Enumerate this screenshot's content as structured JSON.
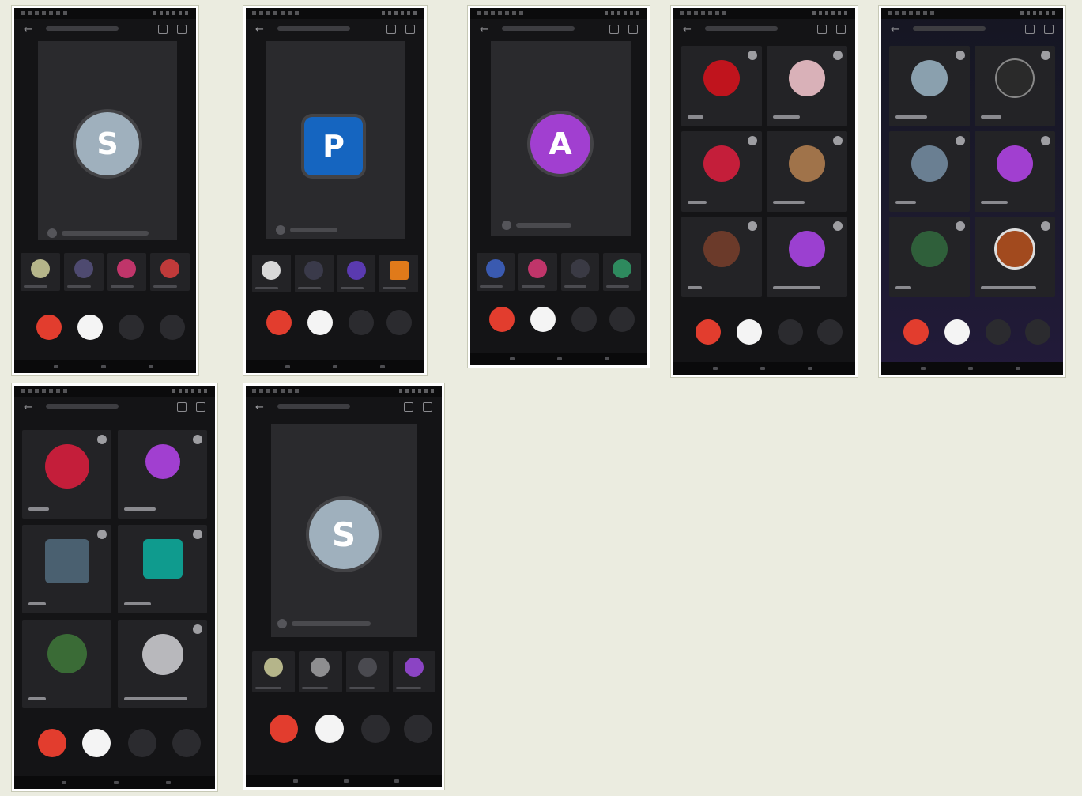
{
  "screens": {
    "s1": {
      "initial": "S",
      "avatar_color": "#9fb0bd"
    },
    "s2": {
      "initial": "P",
      "avatar_color": "#1565c0"
    },
    "s3": {
      "initial": "A",
      "avatar_color": "#a13fd0"
    },
    "s4": {
      "tile_colors": [
        "#c0141d",
        "#d9b1b8",
        "#c41e3a",
        "#a0734a",
        "#6b3a2a",
        "#9b40d0"
      ]
    },
    "s5": {
      "tile_colors": [
        "#8aa0ae",
        "#2a2a2a",
        "#6a7f92",
        "#a13fd0",
        "#2f5f3a",
        "#a24a1e"
      ]
    },
    "s6": {
      "tile_colors": [
        "#c41e3a",
        "#a13fd0",
        "#4a6070",
        "#0f9b8e",
        "#3a6b36",
        "#b8b8bc"
      ]
    },
    "s7": {
      "initial": "S",
      "avatar_color": "#9fb0bd"
    }
  },
  "icons": {
    "back": "←",
    "hang_up": "phone-hangup-icon",
    "camera": "camera-icon"
  },
  "colors": {
    "hang_up": "#e23d2e",
    "background": "#ebece0"
  }
}
